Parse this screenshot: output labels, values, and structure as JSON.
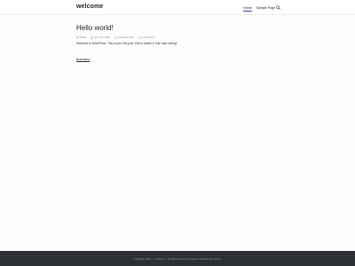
{
  "header": {
    "site_title": "welcome",
    "nav": [
      {
        "label": "Home",
        "active": true
      },
      {
        "label": "Sample Page",
        "active": false
      }
    ],
    "search_icon": "search-icon"
  },
  "post": {
    "title": "Hello world!",
    "meta": {
      "author": "By Rakib",
      "date": "June 20, 2022",
      "category": "Uncategorized",
      "comments": "1 Comment"
    },
    "excerpt": "Welcome to WordPress. This is your first post. Edit or delete it, then start writing!",
    "read_more": "Read More"
  },
  "footer": {
    "copyright": "Copyright 2022 — welcome . All rights reserved. Kadence WordPress Theme"
  },
  "colors": {
    "accent": "#2f3db5",
    "footer_bg": "#2c2f33"
  }
}
